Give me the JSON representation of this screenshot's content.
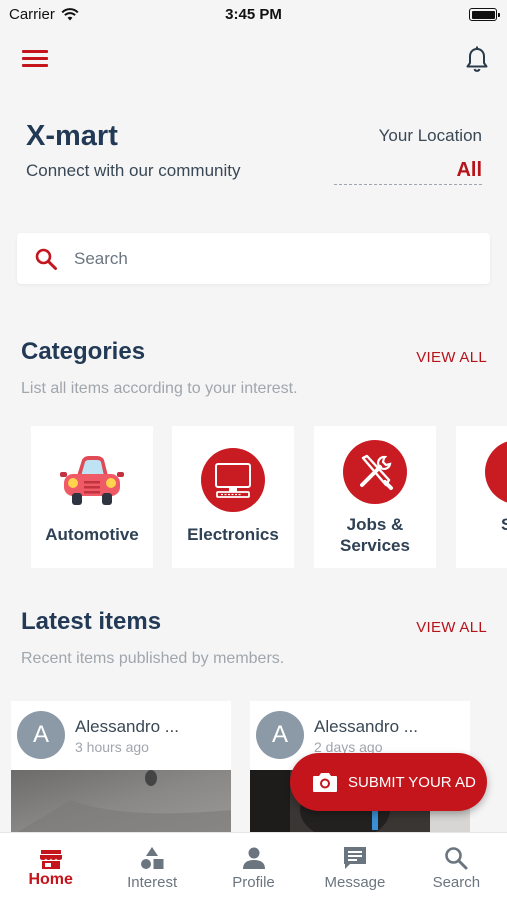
{
  "status": {
    "carrier": "Carrier",
    "time": "3:45 PM"
  },
  "header": {
    "brand": "X-mart",
    "tagline": "Connect with our community",
    "location_label": "Your Location",
    "location_value": "All"
  },
  "search": {
    "placeholder": "Search"
  },
  "categories": {
    "title": "Categories",
    "subtitle": "List all items according to your interest.",
    "view_all": "VIEW ALL",
    "items": [
      {
        "label": "Automotive",
        "icon": "car-icon"
      },
      {
        "label": "Electronics",
        "icon": "monitor-icon"
      },
      {
        "label": "Jobs &\nServices",
        "icon": "tools-icon"
      },
      {
        "label": "Spo\nLe",
        "icon": "sports-icon"
      }
    ]
  },
  "latest": {
    "title": "Latest items",
    "subtitle": "Recent items published by members.",
    "view_all": "VIEW ALL",
    "items": [
      {
        "avatar": "A",
        "name": "Alessandro ...",
        "when": "3 hours ago"
      },
      {
        "avatar": "A",
        "name": "Alessandro ...",
        "when": "2 days ago"
      }
    ]
  },
  "fab": {
    "label": "SUBMIT YOUR AD"
  },
  "nav": {
    "items": [
      {
        "label": "Home",
        "icon": "home-icon",
        "active": true
      },
      {
        "label": "Interest",
        "icon": "interest-icon",
        "active": false
      },
      {
        "label": "Profile",
        "icon": "profile-icon",
        "active": false
      },
      {
        "label": "Message",
        "icon": "message-icon",
        "active": false
      },
      {
        "label": "Search",
        "icon": "search-icon",
        "active": false
      }
    ]
  },
  "colors": {
    "accent": "#c3151b",
    "heading": "#223a56",
    "background": "#f5f5f5"
  }
}
